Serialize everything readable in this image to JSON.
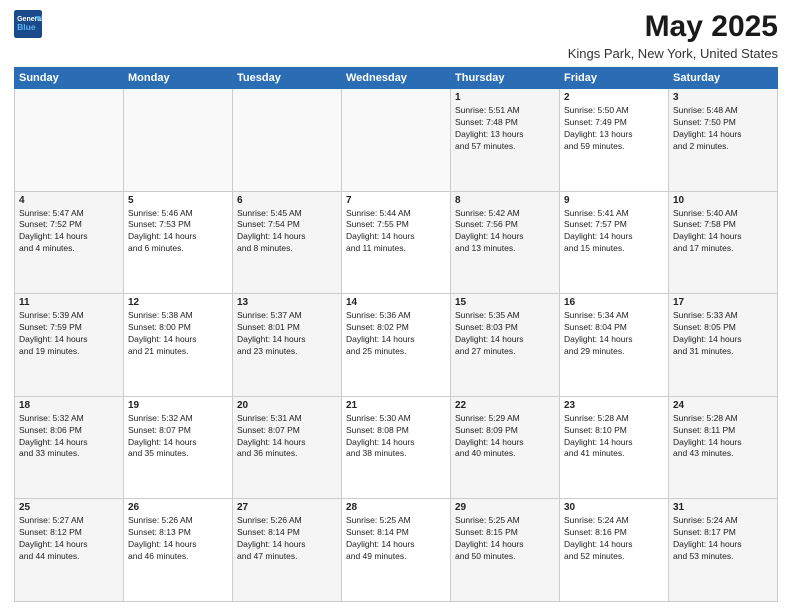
{
  "logo": {
    "line1": "General",
    "line2": "Blue"
  },
  "title": "May 2025",
  "subtitle": "Kings Park, New York, United States",
  "days_header": [
    "Sunday",
    "Monday",
    "Tuesday",
    "Wednesday",
    "Thursday",
    "Friday",
    "Saturday"
  ],
  "weeks": [
    [
      {
        "num": "",
        "info": ""
      },
      {
        "num": "",
        "info": ""
      },
      {
        "num": "",
        "info": ""
      },
      {
        "num": "",
        "info": ""
      },
      {
        "num": "1",
        "info": "Sunrise: 5:51 AM\nSunset: 7:48 PM\nDaylight: 13 hours\nand 57 minutes."
      },
      {
        "num": "2",
        "info": "Sunrise: 5:50 AM\nSunset: 7:49 PM\nDaylight: 13 hours\nand 59 minutes."
      },
      {
        "num": "3",
        "info": "Sunrise: 5:48 AM\nSunset: 7:50 PM\nDaylight: 14 hours\nand 2 minutes."
      }
    ],
    [
      {
        "num": "4",
        "info": "Sunrise: 5:47 AM\nSunset: 7:52 PM\nDaylight: 14 hours\nand 4 minutes."
      },
      {
        "num": "5",
        "info": "Sunrise: 5:46 AM\nSunset: 7:53 PM\nDaylight: 14 hours\nand 6 minutes."
      },
      {
        "num": "6",
        "info": "Sunrise: 5:45 AM\nSunset: 7:54 PM\nDaylight: 14 hours\nand 8 minutes."
      },
      {
        "num": "7",
        "info": "Sunrise: 5:44 AM\nSunset: 7:55 PM\nDaylight: 14 hours\nand 11 minutes."
      },
      {
        "num": "8",
        "info": "Sunrise: 5:42 AM\nSunset: 7:56 PM\nDaylight: 14 hours\nand 13 minutes."
      },
      {
        "num": "9",
        "info": "Sunrise: 5:41 AM\nSunset: 7:57 PM\nDaylight: 14 hours\nand 15 minutes."
      },
      {
        "num": "10",
        "info": "Sunrise: 5:40 AM\nSunset: 7:58 PM\nDaylight: 14 hours\nand 17 minutes."
      }
    ],
    [
      {
        "num": "11",
        "info": "Sunrise: 5:39 AM\nSunset: 7:59 PM\nDaylight: 14 hours\nand 19 minutes."
      },
      {
        "num": "12",
        "info": "Sunrise: 5:38 AM\nSunset: 8:00 PM\nDaylight: 14 hours\nand 21 minutes."
      },
      {
        "num": "13",
        "info": "Sunrise: 5:37 AM\nSunset: 8:01 PM\nDaylight: 14 hours\nand 23 minutes."
      },
      {
        "num": "14",
        "info": "Sunrise: 5:36 AM\nSunset: 8:02 PM\nDaylight: 14 hours\nand 25 minutes."
      },
      {
        "num": "15",
        "info": "Sunrise: 5:35 AM\nSunset: 8:03 PM\nDaylight: 14 hours\nand 27 minutes."
      },
      {
        "num": "16",
        "info": "Sunrise: 5:34 AM\nSunset: 8:04 PM\nDaylight: 14 hours\nand 29 minutes."
      },
      {
        "num": "17",
        "info": "Sunrise: 5:33 AM\nSunset: 8:05 PM\nDaylight: 14 hours\nand 31 minutes."
      }
    ],
    [
      {
        "num": "18",
        "info": "Sunrise: 5:32 AM\nSunset: 8:06 PM\nDaylight: 14 hours\nand 33 minutes."
      },
      {
        "num": "19",
        "info": "Sunrise: 5:32 AM\nSunset: 8:07 PM\nDaylight: 14 hours\nand 35 minutes."
      },
      {
        "num": "20",
        "info": "Sunrise: 5:31 AM\nSunset: 8:07 PM\nDaylight: 14 hours\nand 36 minutes."
      },
      {
        "num": "21",
        "info": "Sunrise: 5:30 AM\nSunset: 8:08 PM\nDaylight: 14 hours\nand 38 minutes."
      },
      {
        "num": "22",
        "info": "Sunrise: 5:29 AM\nSunset: 8:09 PM\nDaylight: 14 hours\nand 40 minutes."
      },
      {
        "num": "23",
        "info": "Sunrise: 5:28 AM\nSunset: 8:10 PM\nDaylight: 14 hours\nand 41 minutes."
      },
      {
        "num": "24",
        "info": "Sunrise: 5:28 AM\nSunset: 8:11 PM\nDaylight: 14 hours\nand 43 minutes."
      }
    ],
    [
      {
        "num": "25",
        "info": "Sunrise: 5:27 AM\nSunset: 8:12 PM\nDaylight: 14 hours\nand 44 minutes."
      },
      {
        "num": "26",
        "info": "Sunrise: 5:26 AM\nSunset: 8:13 PM\nDaylight: 14 hours\nand 46 minutes."
      },
      {
        "num": "27",
        "info": "Sunrise: 5:26 AM\nSunset: 8:14 PM\nDaylight: 14 hours\nand 47 minutes."
      },
      {
        "num": "28",
        "info": "Sunrise: 5:25 AM\nSunset: 8:14 PM\nDaylight: 14 hours\nand 49 minutes."
      },
      {
        "num": "29",
        "info": "Sunrise: 5:25 AM\nSunset: 8:15 PM\nDaylight: 14 hours\nand 50 minutes."
      },
      {
        "num": "30",
        "info": "Sunrise: 5:24 AM\nSunset: 8:16 PM\nDaylight: 14 hours\nand 52 minutes."
      },
      {
        "num": "31",
        "info": "Sunrise: 5:24 AM\nSunset: 8:17 PM\nDaylight: 14 hours\nand 53 minutes."
      }
    ]
  ]
}
